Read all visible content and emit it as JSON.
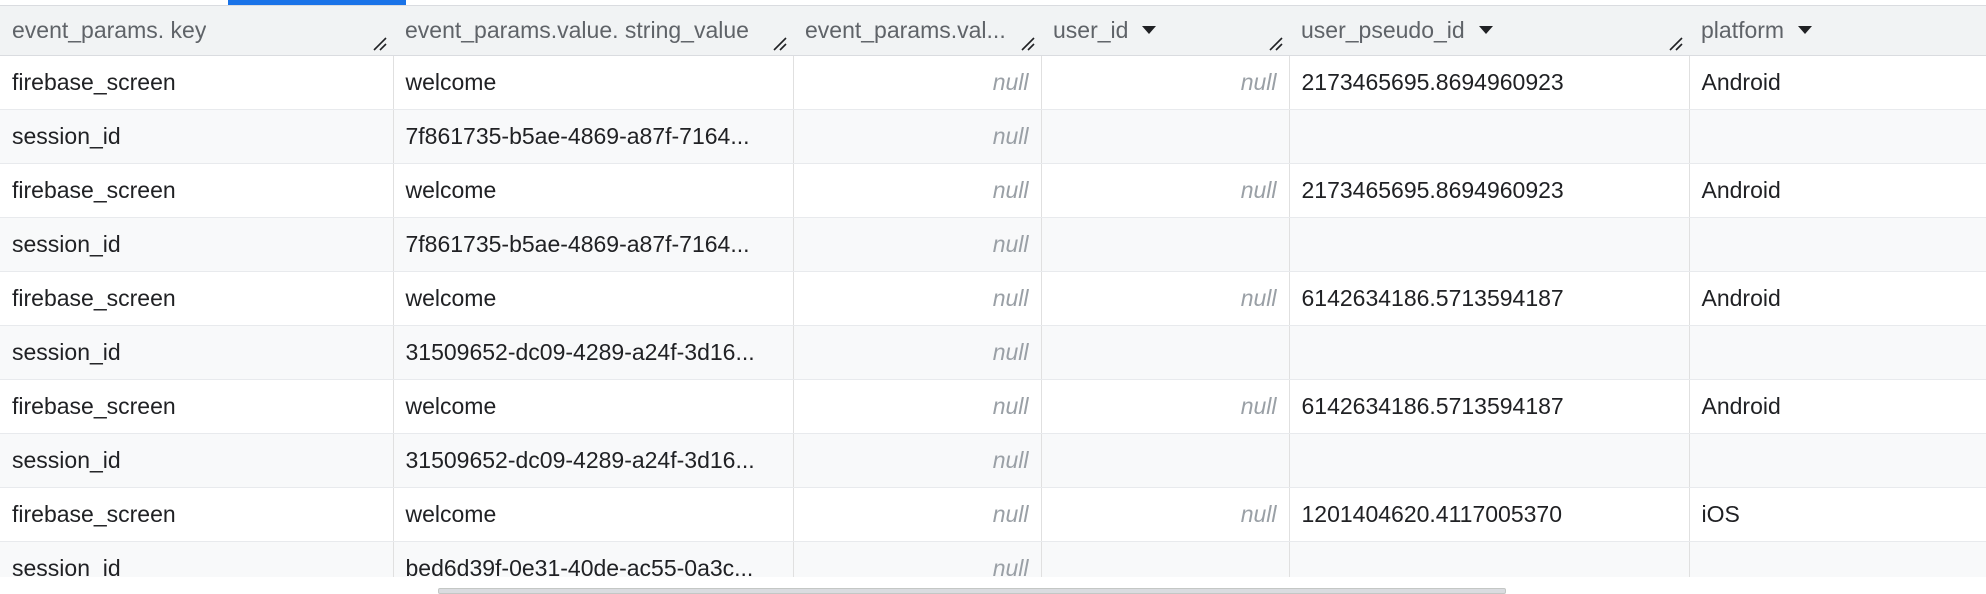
{
  "columns": [
    {
      "label": "event_params. key",
      "sortable": false
    },
    {
      "label": "event_params.value. string_value",
      "sortable": false
    },
    {
      "label": "event_params.val...",
      "sortable": false
    },
    {
      "label": "user_id",
      "sortable": true
    },
    {
      "label": "user_pseudo_id",
      "sortable": true
    },
    {
      "label": "platform",
      "sortable": true
    }
  ],
  "null_text": "null",
  "rows": [
    {
      "key": "firebase_screen",
      "string_value": "welcome",
      "val": "null",
      "user_id": "null",
      "user_pseudo_id": "2173465695.8694960923",
      "platform": "Android"
    },
    {
      "key": "session_id",
      "string_value": "7f861735-b5ae-4869-a87f-7164...",
      "val": "null",
      "user_id": "",
      "user_pseudo_id": "",
      "platform": ""
    },
    {
      "key": "firebase_screen",
      "string_value": "welcome",
      "val": "null",
      "user_id": "null",
      "user_pseudo_id": "2173465695.8694960923",
      "platform": "Android"
    },
    {
      "key": "session_id",
      "string_value": "7f861735-b5ae-4869-a87f-7164...",
      "val": "null",
      "user_id": "",
      "user_pseudo_id": "",
      "platform": ""
    },
    {
      "key": "firebase_screen",
      "string_value": "welcome",
      "val": "null",
      "user_id": "null",
      "user_pseudo_id": "6142634186.5713594187",
      "platform": "Android"
    },
    {
      "key": "session_id",
      "string_value": "31509652-dc09-4289-a24f-3d16...",
      "val": "null",
      "user_id": "",
      "user_pseudo_id": "",
      "platform": ""
    },
    {
      "key": "firebase_screen",
      "string_value": "welcome",
      "val": "null",
      "user_id": "null",
      "user_pseudo_id": "6142634186.5713594187",
      "platform": "Android"
    },
    {
      "key": "session_id",
      "string_value": "31509652-dc09-4289-a24f-3d16...",
      "val": "null",
      "user_id": "",
      "user_pseudo_id": "",
      "platform": ""
    },
    {
      "key": "firebase_screen",
      "string_value": "welcome",
      "val": "null",
      "user_id": "null",
      "user_pseudo_id": "1201404620.4117005370",
      "platform": "iOS"
    },
    {
      "key": "session_id",
      "string_value": "bed6d39f-0e31-40de-ac55-0a3c...",
      "val": "null",
      "user_id": "",
      "user_pseudo_id": "",
      "platform": ""
    }
  ],
  "icons": {
    "sort": "sort-down-icon",
    "resize": "column-resize-icon"
  },
  "colors": {
    "accent": "#1a73e8",
    "header_bg": "#f1f3f4",
    "null_text": "#9aa0a6"
  }
}
